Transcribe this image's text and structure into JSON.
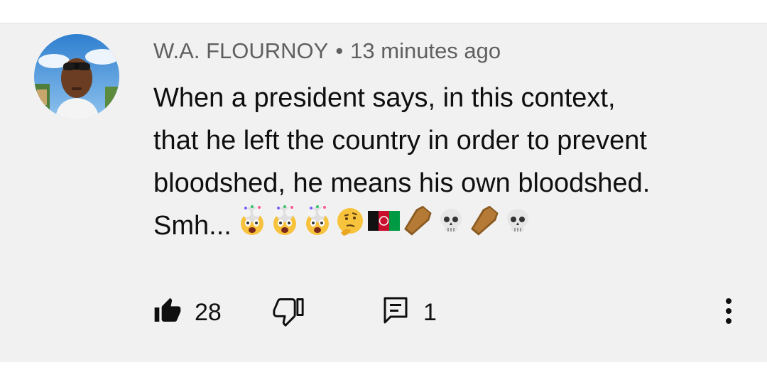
{
  "comment": {
    "author": "W.A. FLOURNOY",
    "separator": "•",
    "timestamp": "13 minutes ago",
    "lines": [
      "When a president says, in this context,",
      "that he left the country in order to prevent",
      "bloodshed, he means his own bloodshed.",
      "Smh..."
    ],
    "emojis": [
      "exploding-head",
      "exploding-head",
      "exploding-head",
      "thinking-face",
      "afghanistan-flag",
      "coffin",
      "skull",
      "coffin",
      "skull"
    ]
  },
  "actions": {
    "like_count": "28",
    "reply_count": "1"
  },
  "icons": {
    "like": "thumbs-up-icon",
    "dislike": "thumbs-down-icon",
    "reply": "reply-icon",
    "more": "more-vert-icon"
  },
  "colors": {
    "card_background": "#f1f1f1",
    "meta_text": "#606060",
    "body_text": "#0f0f0f"
  }
}
